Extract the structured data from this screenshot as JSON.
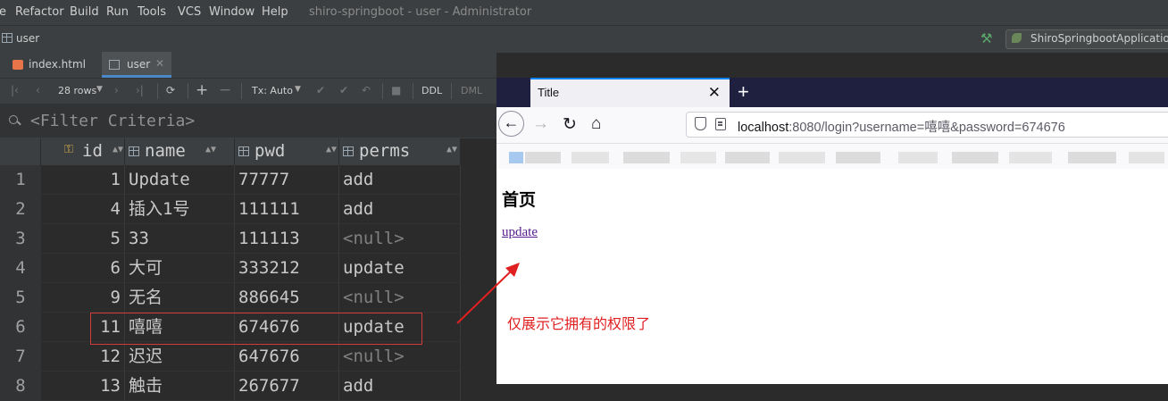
{
  "ide": {
    "menu": [
      "e",
      "Refactor",
      "Build",
      "Run",
      "Tools",
      "VCS",
      "Window",
      "Help"
    ],
    "window_title": "shiro-springboot - user - Administrator",
    "breadcrumb": "user",
    "run_config": "ShiroSpringbootApplication",
    "tabs": [
      {
        "label": "index.html",
        "icon": "html-file-icon"
      },
      {
        "label": "user",
        "icon": "table-icon"
      }
    ],
    "toolbar": {
      "rows": "28 rows",
      "tx": "Tx: Auto",
      "ddl": "DDL",
      "dml": "DML"
    },
    "filter_placeholder": "<Filter Criteria>"
  },
  "grid": {
    "columns": [
      {
        "name": "id",
        "key": true
      },
      {
        "name": "name"
      },
      {
        "name": "pwd"
      },
      {
        "name": "perms"
      }
    ],
    "rows": [
      {
        "n": "1",
        "id": "1",
        "name": "Update",
        "pwd": "77777",
        "perms": "add"
      },
      {
        "n": "2",
        "id": "4",
        "name": "插入1号",
        "pwd": "111111",
        "perms": "add"
      },
      {
        "n": "3",
        "id": "5",
        "name": "33",
        "pwd": "111113",
        "perms": "<null>"
      },
      {
        "n": "4",
        "id": "6",
        "name": "大可",
        "pwd": "333212",
        "perms": "update"
      },
      {
        "n": "5",
        "id": "9",
        "name": "无名",
        "pwd": "886645",
        "perms": "<null>"
      },
      {
        "n": "6",
        "id": "11",
        "name": "嘻嘻",
        "pwd": "674676",
        "perms": "update"
      },
      {
        "n": "7",
        "id": "12",
        "name": "迟迟",
        "pwd": "647676",
        "perms": "<null>"
      },
      {
        "n": "8",
        "id": "13",
        "name": "触击",
        "pwd": "267677",
        "perms": "add"
      }
    ],
    "highlighted_row": 6
  },
  "browser": {
    "tab_title": "Title",
    "url_host": "localhost",
    "url_rest": ":8080/login?username=嘻嘻&password=674676",
    "page_heading": "首页",
    "page_link": "update",
    "annotation": "仅展示它拥有的权限了"
  }
}
